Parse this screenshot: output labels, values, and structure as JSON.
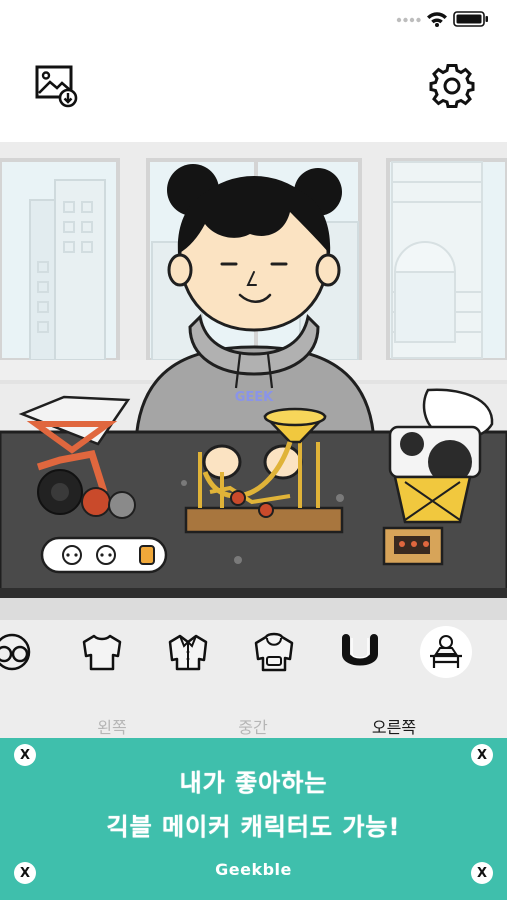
{
  "status_bar": {
    "icons": [
      "signal-dots-icon",
      "wifi-icon",
      "battery-icon"
    ]
  },
  "toolbar": {
    "save_image_icon": "image-download-icon",
    "settings_icon": "gear-icon"
  },
  "scene": {
    "hoodie_logo": "GEEK"
  },
  "categories": {
    "items": [
      {
        "icon": "glasses-icon"
      },
      {
        "icon": "tshirt-icon"
      },
      {
        "icon": "shirt-icon"
      },
      {
        "icon": "hoodie-icon"
      },
      {
        "icon": "magnet-icon"
      },
      {
        "icon": "desk-icon",
        "selected": true
      }
    ]
  },
  "position_tabs": {
    "left": "왼쪽",
    "middle": "중간",
    "right": "오른쪽",
    "active": "right"
  },
  "ad": {
    "line1": "내가 좋아하는",
    "line2": "긱블 메이커 캐릭터도 가능!",
    "brand": "Geekble",
    "close_label": "X",
    "colors": {
      "background": "#3fbfac",
      "text": "#ffffff"
    }
  }
}
